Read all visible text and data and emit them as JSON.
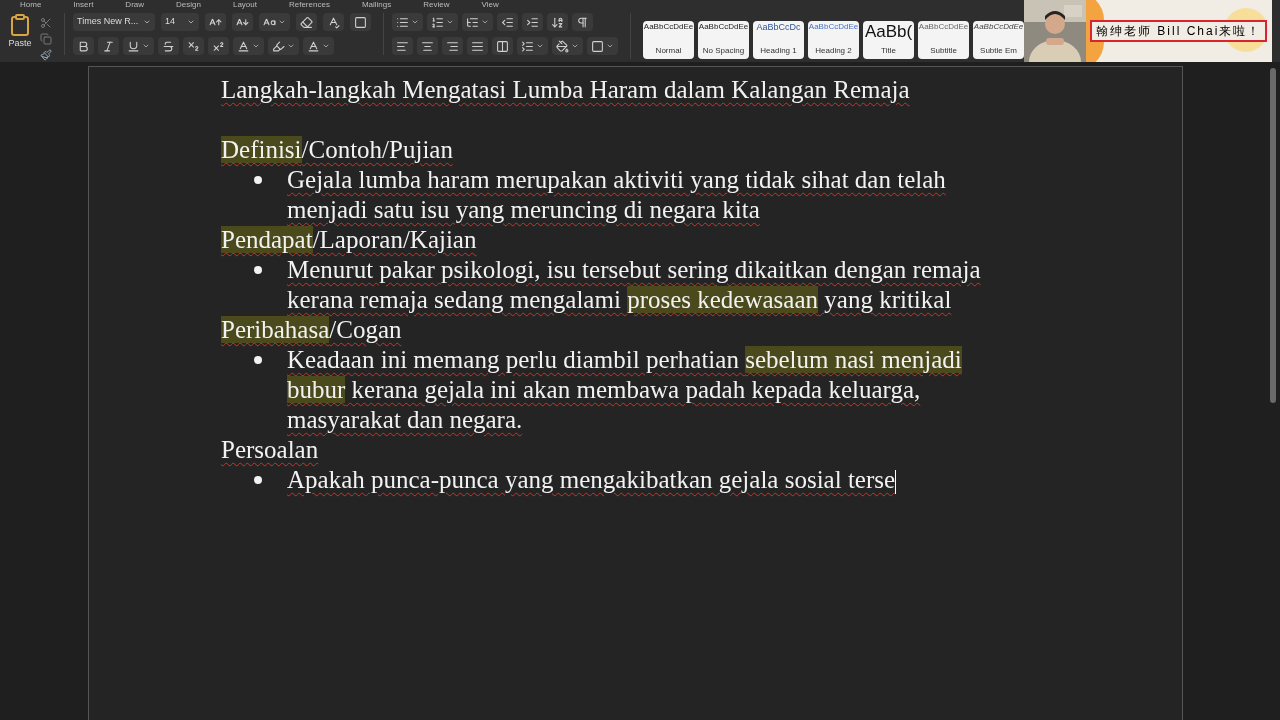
{
  "ribbon_tabs": [
    "Home",
    "Insert",
    "Draw",
    "Design",
    "Layout",
    "References",
    "Mailings",
    "Review",
    "View"
  ],
  "paste_label": "Paste",
  "font_name": "Times New R...",
  "font_size": "14",
  "styles": [
    {
      "sample": "AaBbCcDdEe",
      "name": "Normal",
      "kind": "normal"
    },
    {
      "sample": "AaBbCcDdEe",
      "name": "No Spacing",
      "kind": "normal"
    },
    {
      "sample": "AaBbCcDc",
      "name": "Heading 1",
      "kind": "heading"
    },
    {
      "sample": "AaBbCcDdEe",
      "name": "Heading 2",
      "kind": "heading2"
    },
    {
      "sample": "AaBb(",
      "name": "Title",
      "kind": "title"
    },
    {
      "sample": "AaBbCcDdEe",
      "name": "Subtitle",
      "kind": "subtitle"
    },
    {
      "sample": "AaBbCcDdEe",
      "name": "Subtle Em",
      "kind": "italic"
    }
  ],
  "video_overlay": {
    "kind": "picture",
    "caption": "翰绅老师 Bill Chai来啦！"
  },
  "document": {
    "title": "Langkah-langkah Mengatasi Lumba Haram dalam Kalangan Remaja",
    "sections": [
      {
        "heading": [
          {
            "text": "Definisi",
            "highlighted": true
          },
          {
            "text": "/Contoh/Pujian",
            "highlighted": false
          }
        ],
        "bullets": [
          [
            {
              "text": "Gejala lumba haram merupakan aktiviti yang tidak sihat dan telah menjadi satu isu yang meruncing di negara kita",
              "highlighted": false
            }
          ]
        ]
      },
      {
        "heading": [
          {
            "text": "Pendapat",
            "highlighted": true
          },
          {
            "text": "/Laporan/Kajian",
            "highlighted": false
          }
        ],
        "bullets": [
          [
            {
              "text": "Menurut pakar psikologi, isu tersebut sering dikaitkan dengan remaja kerana remaja sedang mengalami ",
              "highlighted": false
            },
            {
              "text": "proses kedewasaan",
              "highlighted": true
            },
            {
              "text": " yang kritikal",
              "highlighted": false
            }
          ]
        ]
      },
      {
        "heading": [
          {
            "text": "Peribahasa",
            "highlighted": true
          },
          {
            "text": "/Cogan",
            "highlighted": false
          }
        ],
        "bullets": [
          [
            {
              "text": "Keadaan ini memang perlu diambil perhatian ",
              "highlighted": false
            },
            {
              "text": "sebelum nasi menjadi bubur",
              "highlighted": true
            },
            {
              "text": " kerana gejala ini akan membawa padah kepada keluarga, masyarakat dan negara.",
              "highlighted": false
            }
          ]
        ]
      },
      {
        "heading": [
          {
            "text": "Persoalan",
            "highlighted": false
          }
        ],
        "bullets": [
          [
            {
              "text": "Apakah punca-punca yang mengakibatkan gejala sosial terse",
              "highlighted": false
            }
          ]
        ]
      }
    ],
    "cursor_after_last": true
  }
}
